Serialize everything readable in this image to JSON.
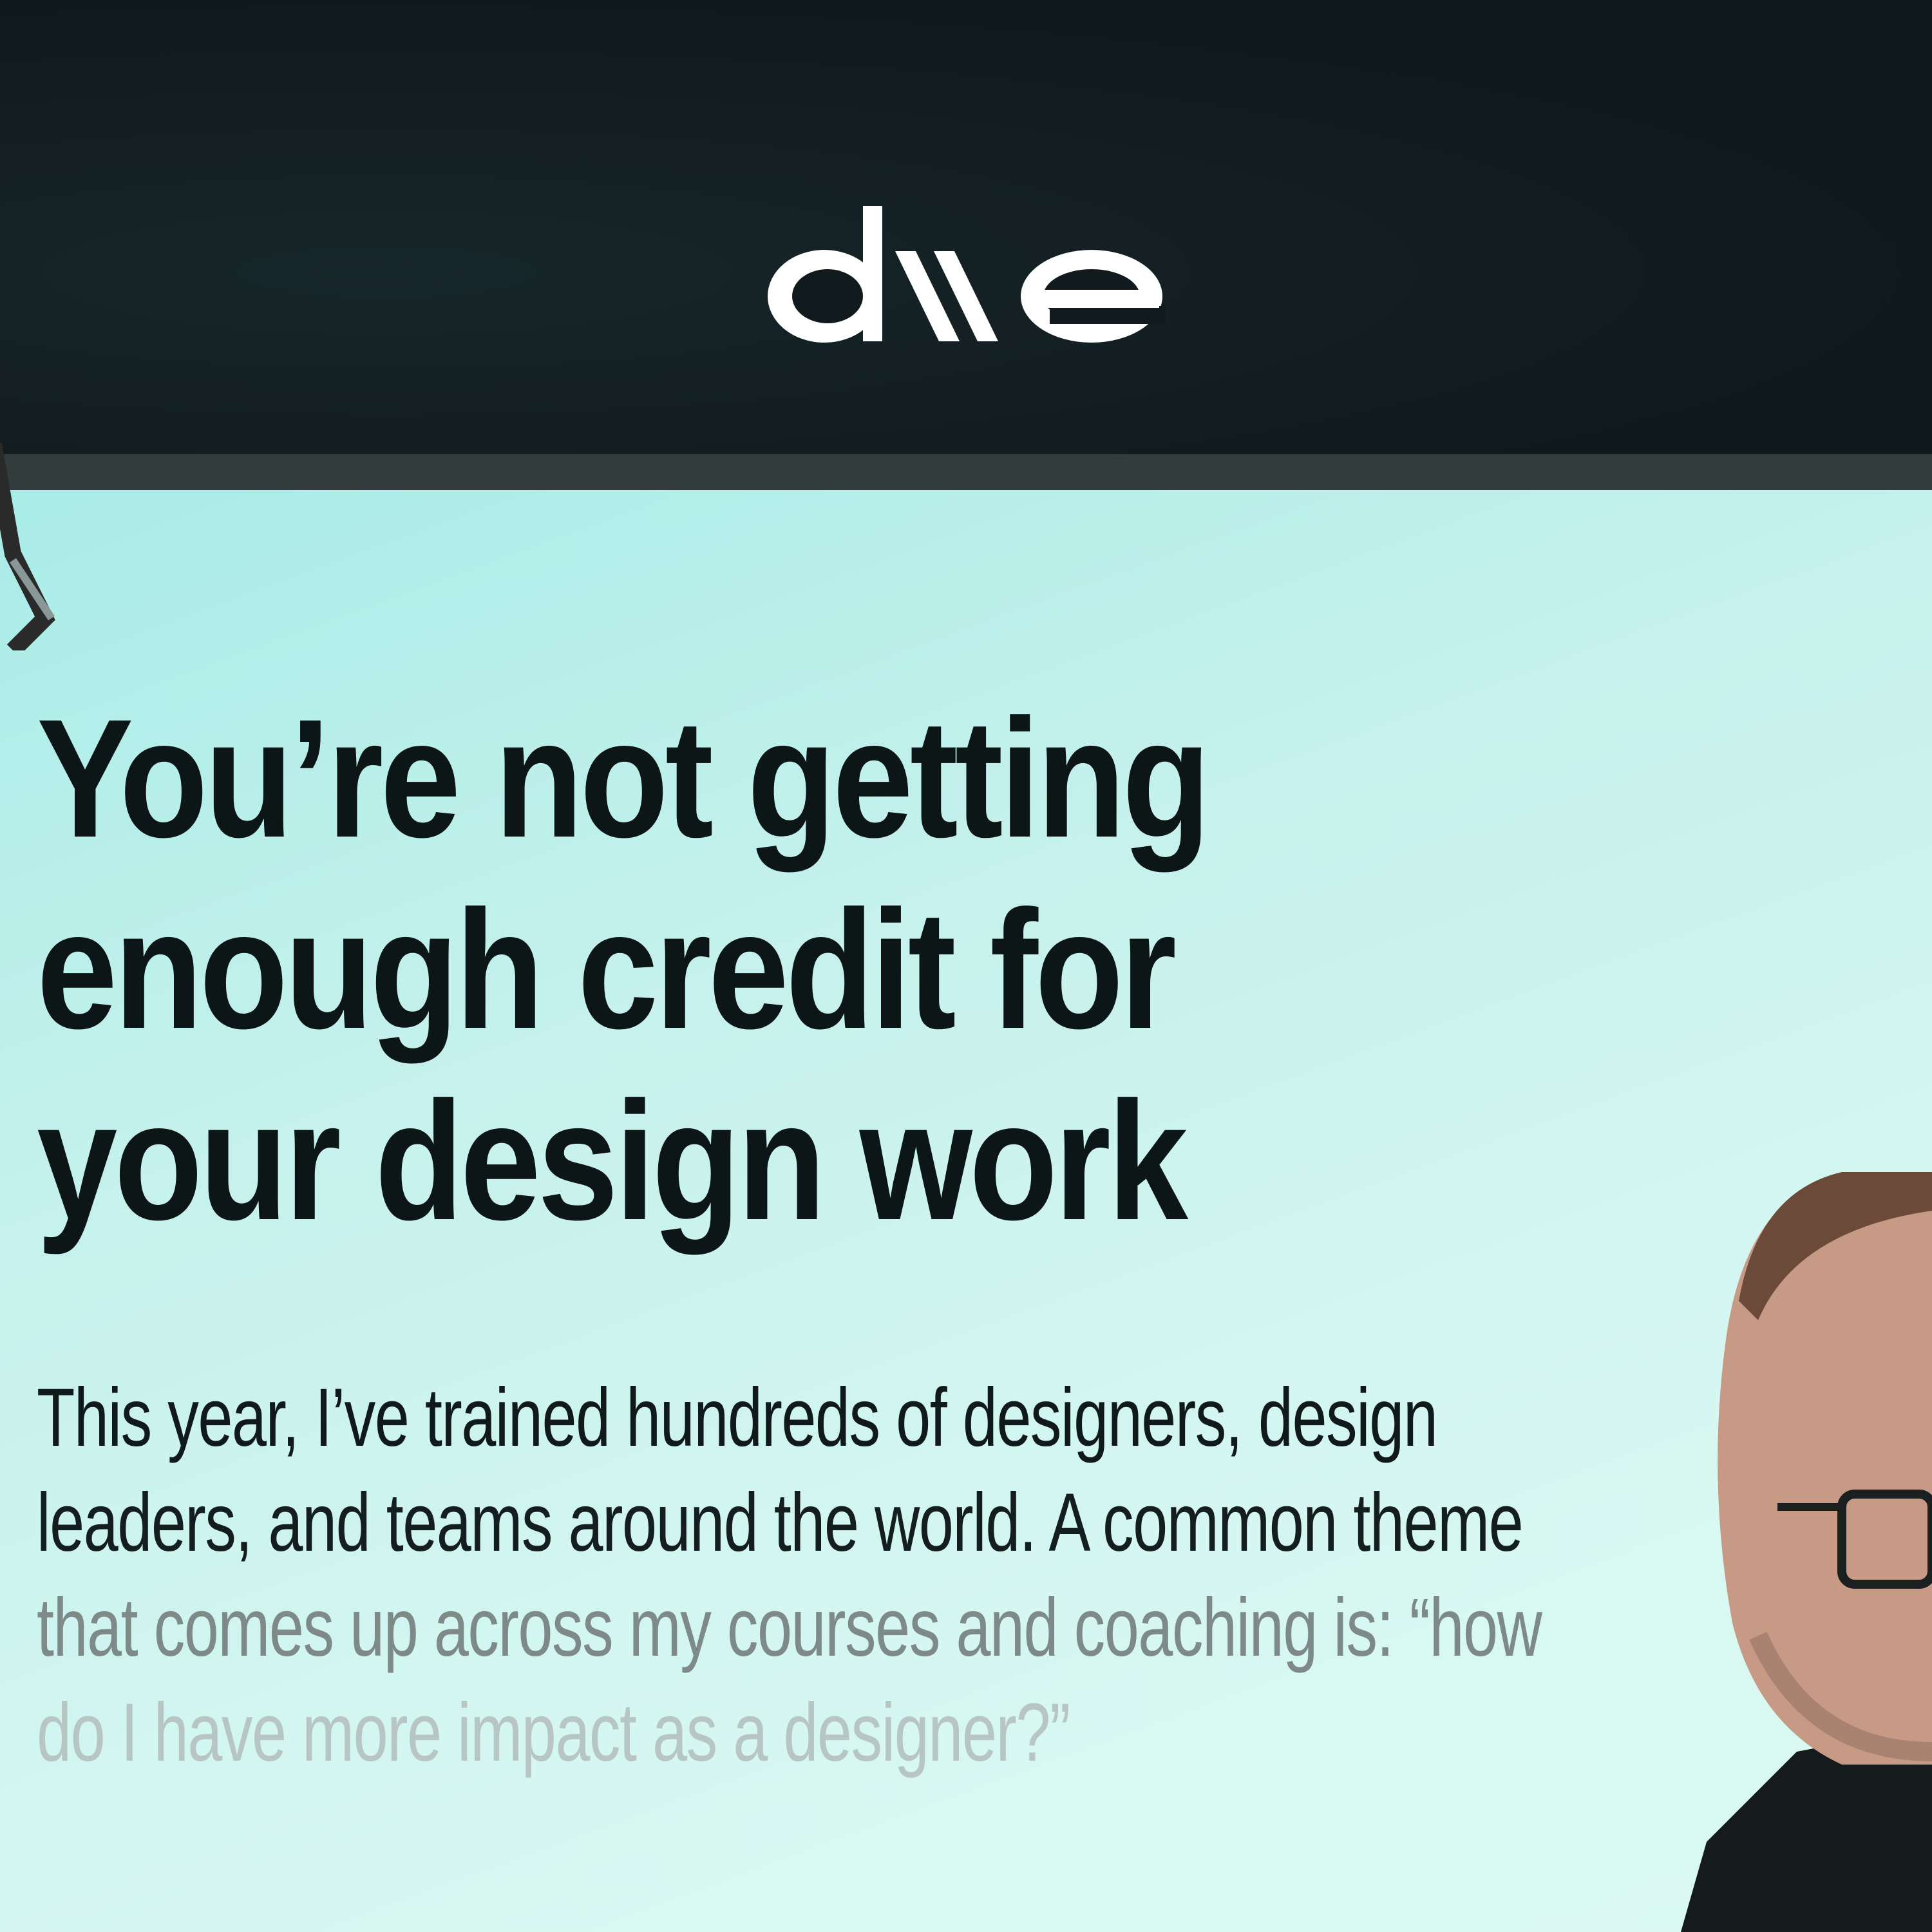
{
  "header": {
    "logo_text": "dive"
  },
  "hero": {
    "headline_lines": [
      "You’re not getting",
      "enough credit for",
      "your design work"
    ],
    "paragraph_lines": [
      "This year, I’ve trained hundreds of designers, design",
      "leaders, and teams around the world. A common theme",
      "that comes up across my courses and coaching is: “how",
      "do I have more impact as a designer?”"
    ]
  },
  "colors": {
    "header_bg": "#111b1d",
    "stripe": "#333c3d",
    "hero_bg": "#d6f7f1",
    "text": "#0d1616",
    "accent_orange": "#f08a1c"
  }
}
